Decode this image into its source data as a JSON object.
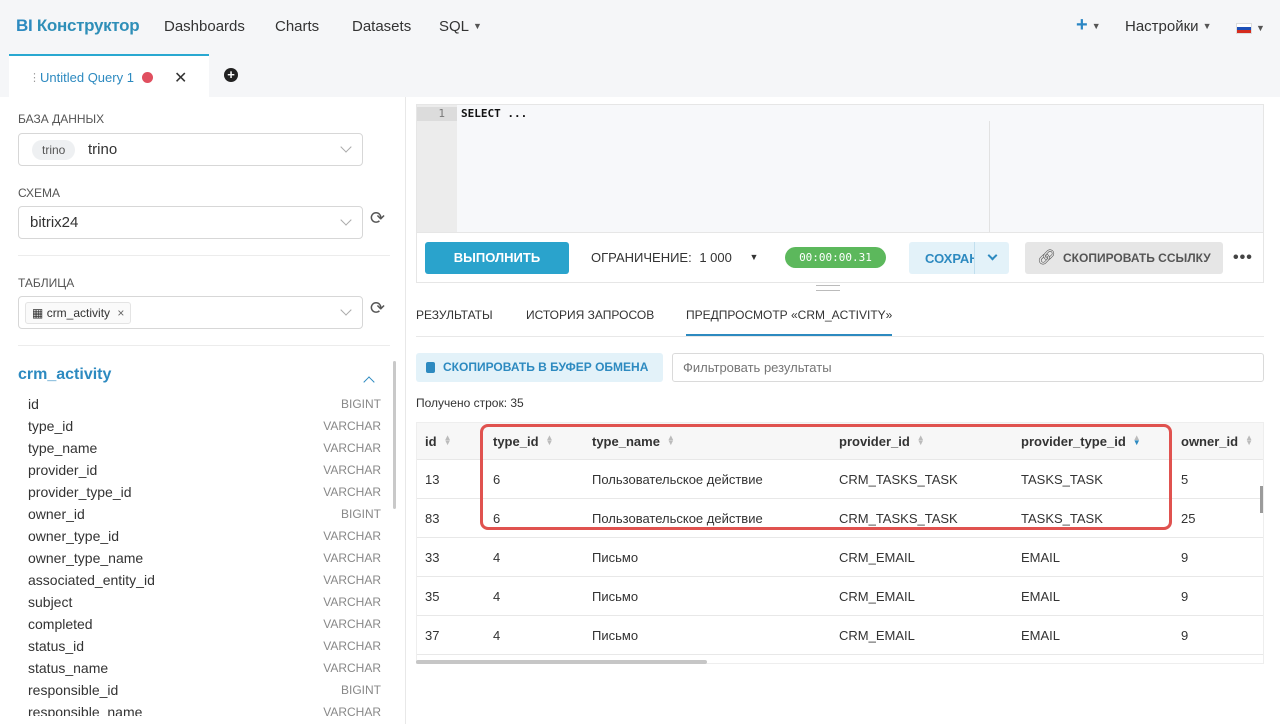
{
  "brand": {
    "prefix": "BI",
    "name": "Конструктор"
  },
  "nav": [
    {
      "label": "Dashboards"
    },
    {
      "label": "Charts"
    },
    {
      "label": "Datasets"
    },
    {
      "label": "SQL"
    }
  ],
  "nav_right": {
    "plus": "+",
    "settings": "Настройки"
  },
  "query_tab": {
    "name": "Untitled Query 1",
    "close": "✕",
    "add": "+"
  },
  "left": {
    "db_label": "БАЗА ДАННЫХ",
    "db_engine": "trino",
    "db_value": "trino",
    "schema_label": "СХЕМА",
    "schema_value": "bitrix24",
    "table_label": "ТАБЛИЦА",
    "table_tag": "crm_activity",
    "table_tag_x": "×",
    "table_name": "crm_activity",
    "columns": [
      {
        "name": "id",
        "type": "BIGINT"
      },
      {
        "name": "type_id",
        "type": "VARCHAR"
      },
      {
        "name": "type_name",
        "type": "VARCHAR"
      },
      {
        "name": "provider_id",
        "type": "VARCHAR"
      },
      {
        "name": "provider_type_id",
        "type": "VARCHAR"
      },
      {
        "name": "owner_id",
        "type": "BIGINT"
      },
      {
        "name": "owner_type_id",
        "type": "VARCHAR"
      },
      {
        "name": "owner_type_name",
        "type": "VARCHAR"
      },
      {
        "name": "associated_entity_id",
        "type": "VARCHAR"
      },
      {
        "name": "subject",
        "type": "VARCHAR"
      },
      {
        "name": "completed",
        "type": "VARCHAR"
      },
      {
        "name": "status_id",
        "type": "VARCHAR"
      },
      {
        "name": "status_name",
        "type": "VARCHAR"
      },
      {
        "name": "responsible_id",
        "type": "BIGINT"
      },
      {
        "name": "responsible_name",
        "type": "VARCHAR"
      }
    ]
  },
  "editor": {
    "line_no": "1",
    "code": "SELECT ..."
  },
  "toolbar": {
    "run": "ВЫПОЛНИТЬ",
    "limit_label": "ОГРАНИЧЕНИЕ:",
    "limit_value": "1 000",
    "timer": "00:00:00.31",
    "save": "СОХРАНИТЬ",
    "copy_link": "СКОПИРОВАТЬ ССЫЛКУ",
    "more": "•••"
  },
  "result_tabs": [
    {
      "label": "РЕЗУЛЬТАТЫ"
    },
    {
      "label": "ИСТОРИЯ ЗАПРОСОВ"
    },
    {
      "label": "ПРЕДПРОСМОТР «CRM_ACTIVITY»",
      "active": true
    }
  ],
  "results": {
    "copy_clipboard": "СКОПИРОВАТЬ В БУФЕР ОБМЕНА",
    "filter_placeholder": "Фильтровать результаты",
    "row_count": "Получено строк: 35",
    "headers": [
      "id",
      "type_id",
      "type_name",
      "provider_id",
      "provider_type_id",
      "owner_id"
    ],
    "rows": [
      [
        "13",
        "6",
        "Пользовательское действие",
        "CRM_TASKS_TASK",
        "TASKS_TASK",
        "5"
      ],
      [
        "83",
        "6",
        "Пользовательское действие",
        "CRM_TASKS_TASK",
        "TASKS_TASK",
        "25"
      ],
      [
        "33",
        "4",
        "Письмо",
        "CRM_EMAIL",
        "EMAIL",
        "9"
      ],
      [
        "35",
        "4",
        "Письмо",
        "CRM_EMAIL",
        "EMAIL",
        "9"
      ],
      [
        "37",
        "4",
        "Письмо",
        "CRM_EMAIL",
        "EMAIL",
        "9"
      ]
    ]
  },
  "colors": {
    "accent": "#2d8ac0",
    "run": "#2aa3cc",
    "timer": "#5cb85c",
    "highlight": "#e0524f"
  }
}
